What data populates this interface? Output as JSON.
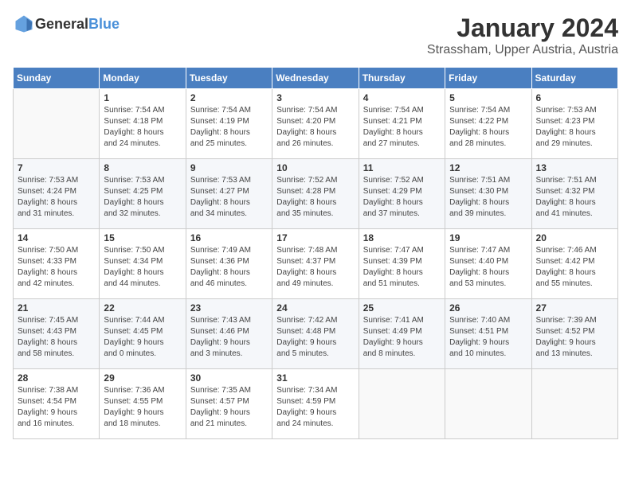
{
  "header": {
    "logo_general": "General",
    "logo_blue": "Blue",
    "month_title": "January 2024",
    "location": "Strassham, Upper Austria, Austria"
  },
  "days_of_week": [
    "Sunday",
    "Monday",
    "Tuesday",
    "Wednesday",
    "Thursday",
    "Friday",
    "Saturday"
  ],
  "weeks": [
    [
      {
        "day": "",
        "details": ""
      },
      {
        "day": "1",
        "details": "Sunrise: 7:54 AM\nSunset: 4:18 PM\nDaylight: 8 hours\nand 24 minutes."
      },
      {
        "day": "2",
        "details": "Sunrise: 7:54 AM\nSunset: 4:19 PM\nDaylight: 8 hours\nand 25 minutes."
      },
      {
        "day": "3",
        "details": "Sunrise: 7:54 AM\nSunset: 4:20 PM\nDaylight: 8 hours\nand 26 minutes."
      },
      {
        "day": "4",
        "details": "Sunrise: 7:54 AM\nSunset: 4:21 PM\nDaylight: 8 hours\nand 27 minutes."
      },
      {
        "day": "5",
        "details": "Sunrise: 7:54 AM\nSunset: 4:22 PM\nDaylight: 8 hours\nand 28 minutes."
      },
      {
        "day": "6",
        "details": "Sunrise: 7:53 AM\nSunset: 4:23 PM\nDaylight: 8 hours\nand 29 minutes."
      }
    ],
    [
      {
        "day": "7",
        "details": "Sunrise: 7:53 AM\nSunset: 4:24 PM\nDaylight: 8 hours\nand 31 minutes."
      },
      {
        "day": "8",
        "details": "Sunrise: 7:53 AM\nSunset: 4:25 PM\nDaylight: 8 hours\nand 32 minutes."
      },
      {
        "day": "9",
        "details": "Sunrise: 7:53 AM\nSunset: 4:27 PM\nDaylight: 8 hours\nand 34 minutes."
      },
      {
        "day": "10",
        "details": "Sunrise: 7:52 AM\nSunset: 4:28 PM\nDaylight: 8 hours\nand 35 minutes."
      },
      {
        "day": "11",
        "details": "Sunrise: 7:52 AM\nSunset: 4:29 PM\nDaylight: 8 hours\nand 37 minutes."
      },
      {
        "day": "12",
        "details": "Sunrise: 7:51 AM\nSunset: 4:30 PM\nDaylight: 8 hours\nand 39 minutes."
      },
      {
        "day": "13",
        "details": "Sunrise: 7:51 AM\nSunset: 4:32 PM\nDaylight: 8 hours\nand 41 minutes."
      }
    ],
    [
      {
        "day": "14",
        "details": "Sunrise: 7:50 AM\nSunset: 4:33 PM\nDaylight: 8 hours\nand 42 minutes."
      },
      {
        "day": "15",
        "details": "Sunrise: 7:50 AM\nSunset: 4:34 PM\nDaylight: 8 hours\nand 44 minutes."
      },
      {
        "day": "16",
        "details": "Sunrise: 7:49 AM\nSunset: 4:36 PM\nDaylight: 8 hours\nand 46 minutes."
      },
      {
        "day": "17",
        "details": "Sunrise: 7:48 AM\nSunset: 4:37 PM\nDaylight: 8 hours\nand 49 minutes."
      },
      {
        "day": "18",
        "details": "Sunrise: 7:47 AM\nSunset: 4:39 PM\nDaylight: 8 hours\nand 51 minutes."
      },
      {
        "day": "19",
        "details": "Sunrise: 7:47 AM\nSunset: 4:40 PM\nDaylight: 8 hours\nand 53 minutes."
      },
      {
        "day": "20",
        "details": "Sunrise: 7:46 AM\nSunset: 4:42 PM\nDaylight: 8 hours\nand 55 minutes."
      }
    ],
    [
      {
        "day": "21",
        "details": "Sunrise: 7:45 AM\nSunset: 4:43 PM\nDaylight: 8 hours\nand 58 minutes."
      },
      {
        "day": "22",
        "details": "Sunrise: 7:44 AM\nSunset: 4:45 PM\nDaylight: 9 hours\nand 0 minutes."
      },
      {
        "day": "23",
        "details": "Sunrise: 7:43 AM\nSunset: 4:46 PM\nDaylight: 9 hours\nand 3 minutes."
      },
      {
        "day": "24",
        "details": "Sunrise: 7:42 AM\nSunset: 4:48 PM\nDaylight: 9 hours\nand 5 minutes."
      },
      {
        "day": "25",
        "details": "Sunrise: 7:41 AM\nSunset: 4:49 PM\nDaylight: 9 hours\nand 8 minutes."
      },
      {
        "day": "26",
        "details": "Sunrise: 7:40 AM\nSunset: 4:51 PM\nDaylight: 9 hours\nand 10 minutes."
      },
      {
        "day": "27",
        "details": "Sunrise: 7:39 AM\nSunset: 4:52 PM\nDaylight: 9 hours\nand 13 minutes."
      }
    ],
    [
      {
        "day": "28",
        "details": "Sunrise: 7:38 AM\nSunset: 4:54 PM\nDaylight: 9 hours\nand 16 minutes."
      },
      {
        "day": "29",
        "details": "Sunrise: 7:36 AM\nSunset: 4:55 PM\nDaylight: 9 hours\nand 18 minutes."
      },
      {
        "day": "30",
        "details": "Sunrise: 7:35 AM\nSunset: 4:57 PM\nDaylight: 9 hours\nand 21 minutes."
      },
      {
        "day": "31",
        "details": "Sunrise: 7:34 AM\nSunset: 4:59 PM\nDaylight: 9 hours\nand 24 minutes."
      },
      {
        "day": "",
        "details": ""
      },
      {
        "day": "",
        "details": ""
      },
      {
        "day": "",
        "details": ""
      }
    ]
  ]
}
